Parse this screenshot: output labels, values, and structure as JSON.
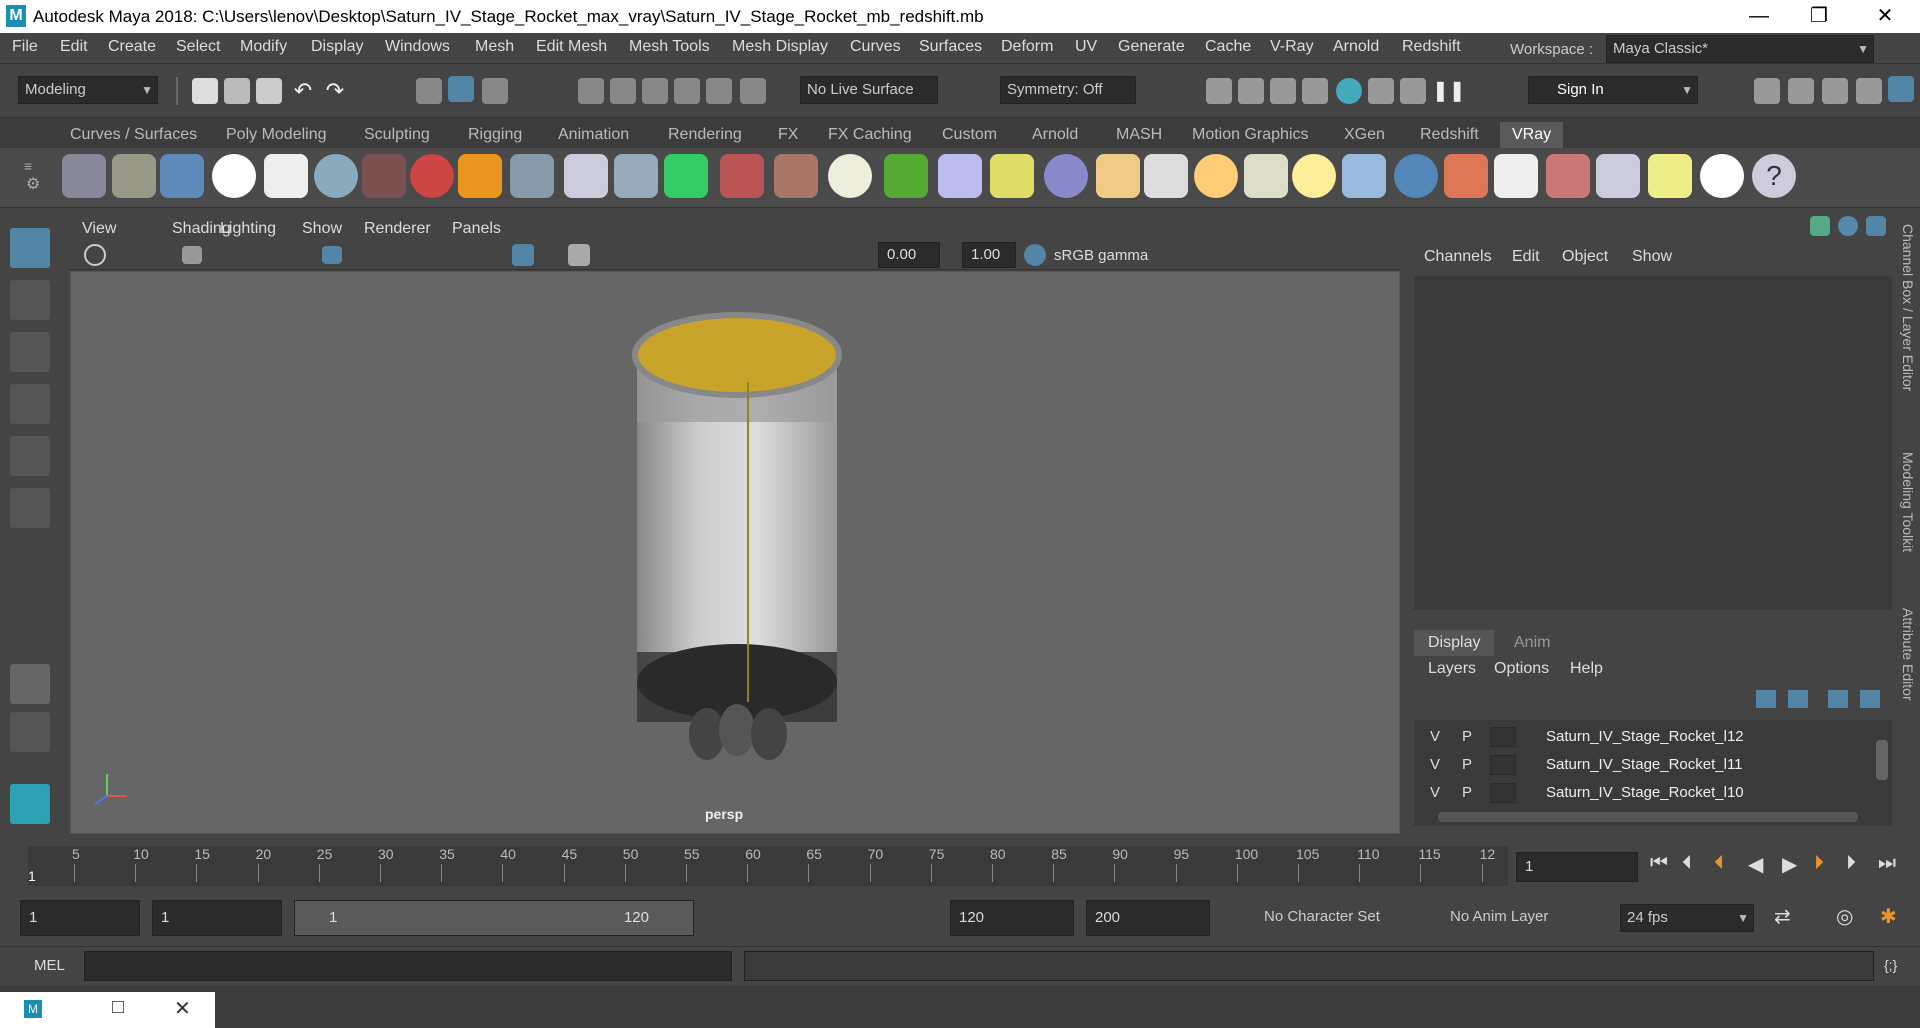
{
  "app": {
    "title": "Autodesk Maya 2018: C:\\Users\\lenov\\Desktop\\Saturn_IV_Stage_Rocket_max_vray\\Saturn_IV_Stage_Rocket_mb_redshift.mb",
    "logo": "M"
  },
  "window_controls": {
    "minimize": "—",
    "maximize": "❐",
    "close": "✕"
  },
  "menubar": {
    "items": [
      "File",
      "Edit",
      "Create",
      "Select",
      "Modify",
      "Display",
      "Windows",
      "Mesh",
      "Edit Mesh",
      "Mesh Tools",
      "Mesh Display",
      "Curves",
      "Surfaces",
      "Deform",
      "UV",
      "Generate",
      "Cache",
      "V-Ray",
      "Arnold",
      "Redshift"
    ],
    "workspace_label": "Workspace :",
    "workspace_value": "Maya Classic*"
  },
  "statusline": {
    "mode": "Modeling",
    "live_surface": "No Live Surface",
    "symmetry": "Symmetry: Off",
    "sign_in": "Sign In"
  },
  "shelf": {
    "tabs": [
      "Curves / Surfaces",
      "Poly Modeling",
      "Sculpting",
      "Rigging",
      "Animation",
      "Rendering",
      "FX",
      "FX Caching",
      "Custom",
      "Arnold",
      "MASH",
      "Motion Graphics",
      "XGen",
      "Redshift",
      "VRay"
    ],
    "active_tab": "VRay"
  },
  "viewport": {
    "menu": [
      "View",
      "Shading",
      "Lighting",
      "Show",
      "Renderer",
      "Panels"
    ],
    "exposure": "0.00",
    "gamma": "1.00",
    "color_space": "sRGB gamma",
    "camera": "persp"
  },
  "channel_box": {
    "menu": [
      "Channels",
      "Edit",
      "Object",
      "Show"
    ]
  },
  "layer_editor": {
    "tabs": [
      "Display",
      "Anim"
    ],
    "active_tab": "Display",
    "menu": [
      "Layers",
      "Options",
      "Help"
    ],
    "layers": [
      {
        "v": "V",
        "p": "P",
        "name": "Saturn_IV_Stage_Rocket_l12"
      },
      {
        "v": "V",
        "p": "P",
        "name": "Saturn_IV_Stage_Rocket_l11"
      },
      {
        "v": "V",
        "p": "P",
        "name": "Saturn_IV_Stage_Rocket_l10"
      }
    ]
  },
  "side_tabs": [
    "Channel Box / Layer Editor",
    "Modeling Toolkit",
    "Attribute Editor"
  ],
  "timeline": {
    "ticks": [
      "5",
      "10",
      "15",
      "20",
      "25",
      "30",
      "35",
      "40",
      "45",
      "50",
      "55",
      "60",
      "65",
      "70",
      "75",
      "80",
      "85",
      "90",
      "95",
      "100",
      "105",
      "110",
      "115",
      "12"
    ],
    "start_marker": "1",
    "current_frame": "1"
  },
  "range": {
    "start": "1",
    "playback_start": "1",
    "slider_start": "1",
    "slider_end": "120",
    "playback_end": "120",
    "end": "200",
    "character_set": "No Character Set",
    "anim_layer": "No Anim Layer",
    "fps": "24 fps"
  },
  "command_line": {
    "label": "MEL"
  },
  "colors": {
    "accent": "#5285a6",
    "yellow_cap": "#c9a42a",
    "viewport_bg": "#666666"
  }
}
